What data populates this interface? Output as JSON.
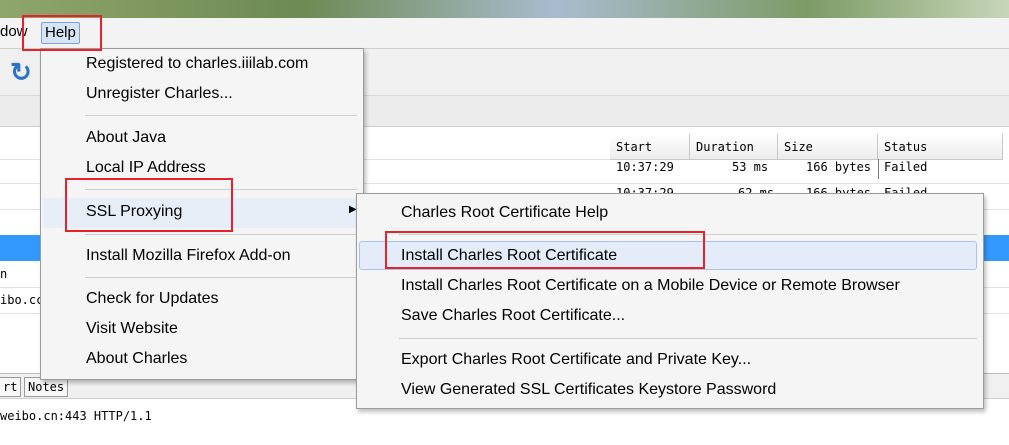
{
  "menubar": {
    "window_partial": "dow",
    "help": "Help"
  },
  "help_menu": {
    "items": [
      "Registered to charles.iiilab.com",
      "Unregister Charles...",
      "About Java",
      "Local IP Address",
      "SSL Proxying",
      "Install Mozilla Firefox Add-on",
      "Check for Updates",
      "Visit Website",
      "About Charles"
    ]
  },
  "ssl_submenu": {
    "items": [
      "Charles Root Certificate Help",
      "Install Charles Root Certificate",
      "Install Charles Root Certificate on a Mobile Device or Remote Browser",
      "Save Charles Root Certificate...",
      "Export Charles Root Certificate and Private Key...",
      "View Generated SSL Certificates Keystore Password"
    ]
  },
  "table": {
    "headers": [
      "Start",
      "Duration",
      "Size",
      "Status"
    ],
    "row1": {
      "start": "10:37:29",
      "duration": "53 ms",
      "size": "166 bytes",
      "status": "Failed"
    },
    "row2": {
      "start": "10:37:29",
      "duration": "62 ms",
      "size": "166 bytes",
      "status": "Failed"
    },
    "left_fragments": [
      "n",
      "ibo.cc"
    ]
  },
  "bottom_tabs": [
    "rt",
    "Notes"
  ],
  "status_text": "weibo.cn:443 HTTP/1.1",
  "colors": {
    "annotation": "#e8222a",
    "selection": "#3399ff",
    "menu_bg": "#f5f5f5"
  },
  "icons": [
    "refresh-icon",
    "submenu-arrow-icon"
  ]
}
